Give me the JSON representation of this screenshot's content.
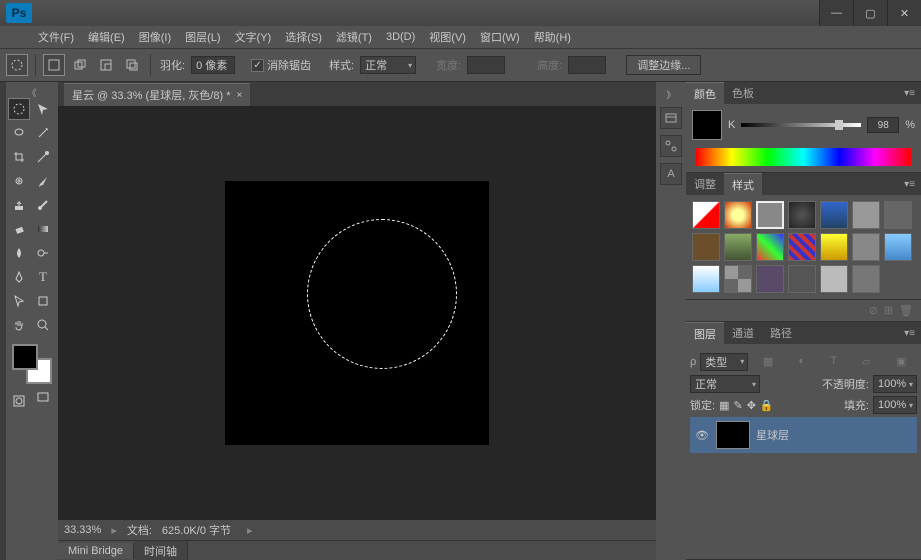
{
  "app": {
    "logo": "Ps"
  },
  "menu": {
    "file": "文件(F)",
    "edit": "编辑(E)",
    "image": "图像(I)",
    "layer": "图层(L)",
    "type": "文字(Y)",
    "select": "选择(S)",
    "filter": "滤镜(T)",
    "threeD": "3D(D)",
    "view": "视图(V)",
    "window": "窗口(W)",
    "help": "帮助(H)"
  },
  "options": {
    "feather_label": "羽化:",
    "feather_value": "0 像素",
    "antialias": "消除锯齿",
    "style_label": "样式:",
    "style_value": "正常",
    "width_label": "宽度:",
    "height_label": "高度:",
    "refine_edge": "调整边缘..."
  },
  "document": {
    "tab_title": "星云 @ 33.3% (星球层, 灰色/8) *",
    "zoom": "33.33%",
    "status_label": "文档:",
    "status_value": "625.0K/0 字节"
  },
  "bottom_tabs": {
    "mini_bridge": "Mini Bridge",
    "timeline": "时间轴"
  },
  "panels": {
    "color": {
      "tab_color": "颜色",
      "tab_swatches": "色板",
      "channel": "K",
      "value": "98",
      "unit": "%"
    },
    "adjust": {
      "tab_adjust": "调整",
      "tab_styles": "样式"
    },
    "layers": {
      "tab_layers": "图层",
      "tab_channels": "通道",
      "tab_paths": "路径",
      "kind": "类型",
      "blend": "正常",
      "opacity_label": "不透明度:",
      "opacity_value": "100%",
      "lock_label": "锁定:",
      "fill_label": "填充:",
      "fill_value": "100%",
      "layer_name": "星球层"
    }
  }
}
